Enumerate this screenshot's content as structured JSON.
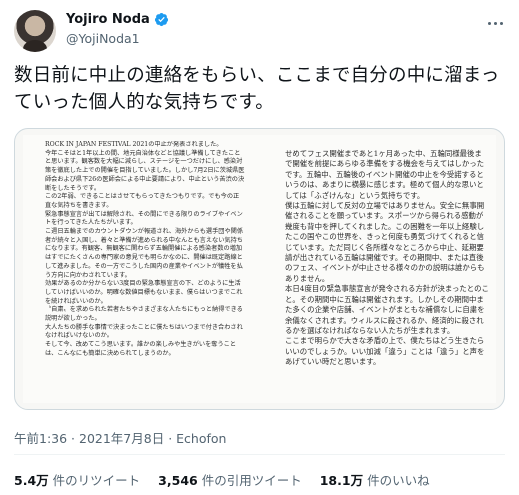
{
  "user": {
    "display_name": "Yojiro Noda",
    "handle": "@YojiNoda1",
    "verified_icon": "verified-badge-icon",
    "avatar_icon": "avatar-photo"
  },
  "tweet": {
    "text": "数日前に中止の連絡をもらい、ここまで自分の中に溜まっていった個人的な気持ちです。"
  },
  "media": {
    "left_column": "ROCK IN JAPAN FESTIVAL 2021の中止が発表されました。\n今年こそはと1年以上の間、地元自治体などと協議し準備してきたことと思います。観客数を大幅に減らし、ステージを一つだけにし、感染対策を徹底した上での開催を目指していました。しかし7月2日に茨城県医師会および県下26の医師会による中止要請により、中止という苦渋の決断をしたそうです。\nこの2年弱、できることはさせてもらってきたつもりです。でも今の正直な気持ちを書きます。\n緊急事態宣言が出ては解除され、その間にできる限りのライブやイベントを行ってきた人たちがいます。\nこ週日五輪までのカウントダウンが報道され、海外からも選手団や関係者が続々と入国し、着々と準備が進められる中なんとも言えない気持ちになります。有観客、無観客に関わらず五輪開催による感染者数の増加はすでにたくさんの専門家の意見でも明らかなのに、開催は既定路線として進みました。その一方でこうした国内の産業やイベントが犠牲を払う方向に向かわされています。\n効果があるのか分からない3度目の緊急事態宣言の下、どのように生活していけばいいのか。明確な数値目標もないまま、僕らはいつまでこれを続ければいいのか。\n〝自粛〟を求められた若者たちやさまざまな人たちにもっと納得できる説明が欲しかった。\n大人たちの勝手な事情で決まったことに僕たちはいつまで付き合わされなければいけないのか。\nそして今、改めてこう思います。誰かの楽しみや生きがいを奪うことは、こんなにも簡単に決められてしまうのか。",
    "right_column": "せめてフェス開催まであと1ヶ月あった中、五輪同様最後まで開催を前提にあらゆる準備をする機会を与えてはしかったです。五輪中、五輪後のイベント開催の中止を今受諾するというのは、あまりに横暴に感じます。極めて個人的な思いとしては「ふざけんな」という気持ちです。\n僕は五輪に対して反対の立場ではありません。安全に無事開催されることを願っています。スポーツから得られる感動が幾度も背中を押してくれました。この困難を一年以上経験したこの国やこの世界を、きっと何度も勇気づけてくれると信じています。ただ同じく各所様々なところから中止、延期要請が出されている五輪は開催です。その期間中、または直後のフェス、イベントが中止させる様々のかの説明は誰からもありません。\n本日4度目の緊急事態宣言が発令される方針が決まったとのこと。その期間中に五輪は開催されます。しかしその期間中また多くの企業や店舗、イベントがまともな補償なしに自粛を余儀なくされます。ウィルスに殺されるか、経済的に殺されるかを選ばなければならない人たちが生まれます。\nここまで明らかで大きな矛盾の上で、僕たちはどう生きたらいいのでしょうか。いい加減「違う」ことは「違う」と声をあげていい時だと思います。"
  },
  "meta": {
    "time": "午前1:36",
    "separator": " · ",
    "date": "2021年7月8日",
    "app": "Echofon"
  },
  "stats": {
    "retweets_value": "5.4万",
    "retweets_label": "件のリツイート",
    "quotes_value": "3,546",
    "quotes_label": "件の引用ツイート",
    "likes_value": "18.1万",
    "likes_label": "件のいいね"
  }
}
